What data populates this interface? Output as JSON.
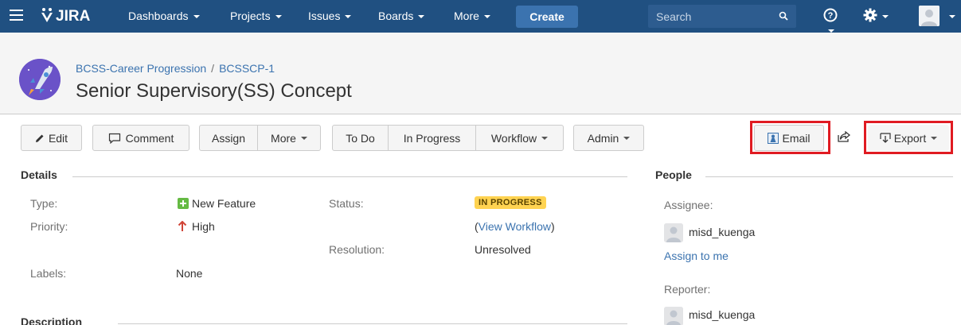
{
  "nav": {
    "logo": "JIRA",
    "dashboards": "Dashboards",
    "projects": "Projects",
    "issues": "Issues",
    "boards": "Boards",
    "more": "More",
    "create": "Create",
    "search_placeholder": "Search",
    "help_glyph": "?"
  },
  "header": {
    "breadcrumb_project": "BCSS-Career Progression",
    "breadcrumb_sep": "/",
    "breadcrumb_issue": "BCSSCP-1",
    "title": "Senior Supervisory(SS) Concept"
  },
  "toolbar": {
    "edit": "Edit",
    "comment": "Comment",
    "assign": "Assign",
    "more": "More",
    "todo": "To Do",
    "in_progress": "In Progress",
    "workflow": "Workflow",
    "admin": "Admin",
    "email": "Email",
    "export": "Export"
  },
  "details": {
    "heading": "Details",
    "type_label": "Type:",
    "type_value": "New Feature",
    "priority_label": "Priority:",
    "priority_value": "High",
    "labels_label": "Labels:",
    "labels_value": "None",
    "status_label": "Status:",
    "status_value": "IN PROGRESS",
    "view_workflow": "View Workflow",
    "paren_open": "(",
    "paren_close": ")",
    "resolution_label": "Resolution:",
    "resolution_value": "Unresolved"
  },
  "description": {
    "heading": "Description"
  },
  "people": {
    "heading": "People",
    "assignee_label": "Assignee:",
    "assignee_name": "misd_kuenga",
    "assign_to_me": "Assign to me",
    "reporter_label": "Reporter:",
    "reporter_name": "misd_kuenga"
  },
  "colors": {
    "nav_bg": "#205081",
    "create_bg": "#3b73af",
    "link": "#3b73af",
    "lozenge_bg": "#ffd351",
    "highlight": "#e01b22",
    "new_feature": "#65ba43",
    "priority_high": "#d04437"
  }
}
